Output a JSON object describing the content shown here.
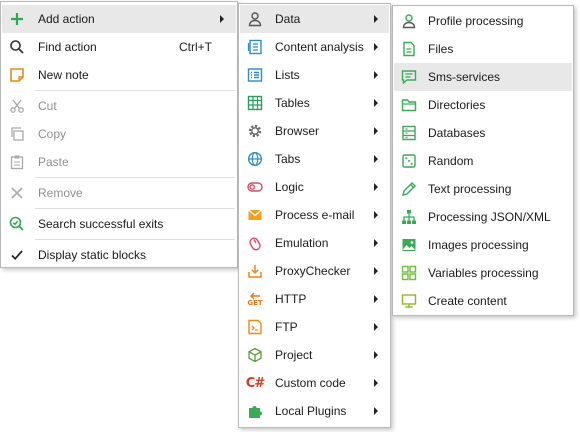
{
  "main_menu": {
    "items": [
      {
        "label": "Add action",
        "icon": "plus-icon"
      },
      {
        "label": "Find action",
        "shortcut": "Ctrl+T",
        "icon": "search-icon"
      },
      {
        "label": "New note",
        "icon": "note-icon"
      },
      {
        "label": "Cut",
        "icon": "scissors-icon",
        "disabled": true
      },
      {
        "label": "Copy",
        "icon": "copy-icon",
        "disabled": true
      },
      {
        "label": "Paste",
        "icon": "paste-icon",
        "disabled": true
      },
      {
        "label": "Remove",
        "icon": "close-icon",
        "disabled": true
      },
      {
        "label": "Search successful exits",
        "icon": "search-check-icon"
      },
      {
        "label": "Display static blocks",
        "icon": "checkmark-icon",
        "checked": true
      }
    ]
  },
  "actions_menu": {
    "items": [
      {
        "label": "Data",
        "icon": "user-icon"
      },
      {
        "label": "Content analysis",
        "icon": "content-analysis-icon"
      },
      {
        "label": "Lists",
        "icon": "list-icon"
      },
      {
        "label": "Tables",
        "icon": "table-icon"
      },
      {
        "label": "Browser",
        "icon": "gear-icon"
      },
      {
        "label": "Tabs",
        "icon": "globe-icon"
      },
      {
        "label": "Logic",
        "icon": "toggle-icon"
      },
      {
        "label": "Process e-mail",
        "icon": "envelope-icon"
      },
      {
        "label": "Emulation",
        "icon": "mouse-icon"
      },
      {
        "label": "ProxyChecker",
        "icon": "proxy-download-icon"
      },
      {
        "label": "HTTP",
        "icon": "http-get-icon",
        "icon_text": "GET"
      },
      {
        "label": "FTP",
        "icon": "ftp-icon"
      },
      {
        "label": "Project",
        "icon": "cube-icon"
      },
      {
        "label": "Custom code",
        "icon": "csharp-icon",
        "icon_text": "C#"
      },
      {
        "label": "Local Plugins",
        "icon": "puzzle-icon"
      }
    ]
  },
  "data_menu": {
    "items": [
      {
        "label": "Profile processing",
        "icon": "user-icon"
      },
      {
        "label": "Files",
        "icon": "file-icon"
      },
      {
        "label": "Sms-services",
        "icon": "sms-icon"
      },
      {
        "label": "Directories",
        "icon": "folder-icon"
      },
      {
        "label": "Databases",
        "icon": "database-icon"
      },
      {
        "label": "Random",
        "icon": "dice-icon"
      },
      {
        "label": "Text processing",
        "icon": "pencil-icon"
      },
      {
        "label": "Processing JSON/XML",
        "icon": "tree-icon"
      },
      {
        "label": "Images processing",
        "icon": "image-icon"
      },
      {
        "label": "Variables processing",
        "icon": "variables-grid-icon"
      },
      {
        "label": "Create content",
        "icon": "monitor-icon"
      }
    ]
  },
  "colors": {
    "highlight": "#e8e8e8",
    "accent_green": "#3aaa55",
    "accent_blue": "#2b8ccf",
    "accent_orange": "#e8891e",
    "accent_red": "#d93a26"
  }
}
